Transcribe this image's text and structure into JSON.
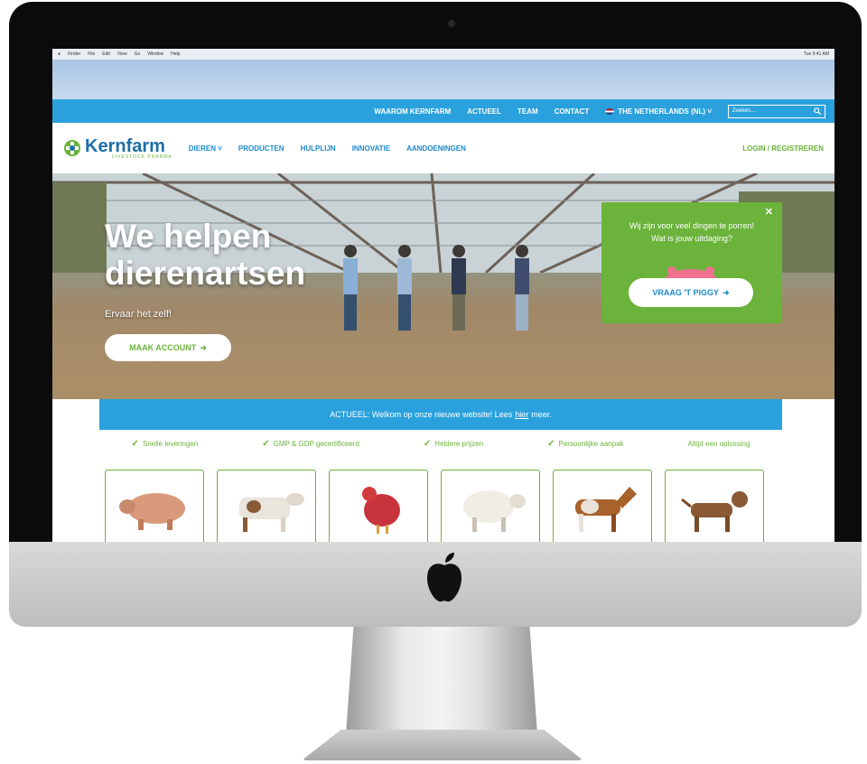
{
  "menubar": {
    "items": [
      "Finder",
      "File",
      "Edit",
      "View",
      "Go",
      "Window",
      "Help"
    ],
    "clock": "Tue 9:41 AM"
  },
  "topbar": {
    "links": [
      "WAAROM KERNFARM",
      "ACTUEEL",
      "TEAM",
      "CONTACT"
    ],
    "country": "THE NETHERLANDS (NL)",
    "search_placeholder": "Zoeken...."
  },
  "logo": {
    "name": "Kernfarm",
    "tagline": "LIVESTOCK PHARMA"
  },
  "nav": {
    "items": [
      "DIEREN",
      "PRODUCTEN",
      "HULPLIJN",
      "INNOVATIE",
      "AANDOENINGEN"
    ],
    "login": "LOGIN / REGISTREREN"
  },
  "hero": {
    "title_line1": "We helpen",
    "title_line2": "dierenartsen",
    "subtitle": "Ervaar het zelf!",
    "cta": "MAAK ACCOUNT"
  },
  "popup": {
    "line1": "Wij zijn voor veel dingen te porren!",
    "line2": "Wat is jouw uitdaging?",
    "button": "VRAAG 'T PIGGY"
  },
  "news": {
    "prefix": "ACTUEEL: Welkom op onze nieuwe website! Lees",
    "link": "hier",
    "suffix": "meer."
  },
  "usps": [
    "Snelle leveringen",
    "GMP & GDP gecertificeerd",
    "Heldere prijzen",
    "Persoonlijke aanpak",
    "Altijd een oplossing"
  ],
  "colors": {
    "brand_blue": "#2aa1dd",
    "brand_green": "#6bb33a",
    "logo_blue": "#1d6fa8"
  },
  "icons": [
    "apple-icon",
    "search-icon",
    "chevron-down-icon",
    "arrow-right-icon",
    "check-icon",
    "close-icon",
    "netherlands-flag-icon"
  ]
}
